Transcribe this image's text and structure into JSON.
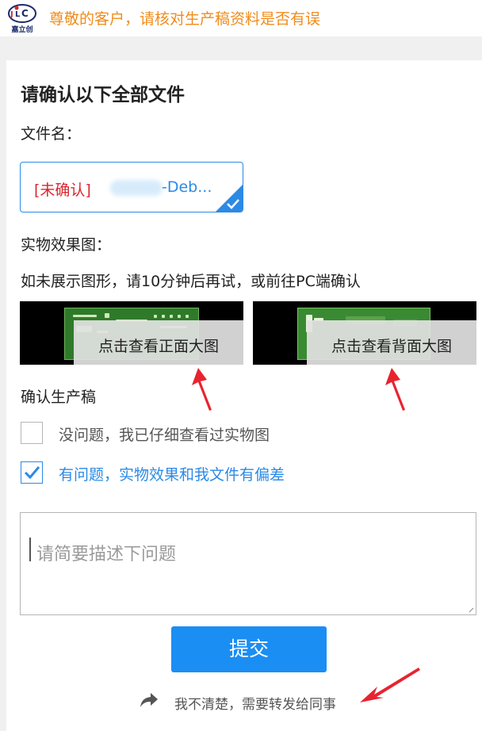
{
  "header": {
    "logo_text": "嘉立创",
    "notice": "尊敬的客户，请核对生产稿资料是否有误"
  },
  "card": {
    "title": "请确认以下全部文件",
    "file_label": "文件名：",
    "file": {
      "status": "[未确认]",
      "name": "-Deb..."
    },
    "preview_label": "实物效果图：",
    "preview_hint": "如未展示图形，请10分钟后再试，或前往PC端确认",
    "front_image": {
      "label": "点击查看正面大图"
    },
    "back_image": {
      "label": "点击查看背面大图"
    },
    "confirm_label": "确认生产稿",
    "options": [
      {
        "label": "没问题，我已仔细查看过实物图",
        "checked": false
      },
      {
        "label": "有问题，实物效果和我文件有偏差",
        "checked": true
      }
    ],
    "description": {
      "placeholder": "请简要描述下问题",
      "value": ""
    },
    "submit_label": "提交",
    "forward_label": "我不清楚，需要转发给同事"
  },
  "colors": {
    "accent": "#1b8ef3",
    "notice": "#f08c1c",
    "unconfirmed": "#d9272e",
    "annotation_arrow": "#e8232f"
  },
  "icons": [
    "logo-icon",
    "check-icon",
    "forward-arrow-icon",
    "resize-handle-icon"
  ]
}
